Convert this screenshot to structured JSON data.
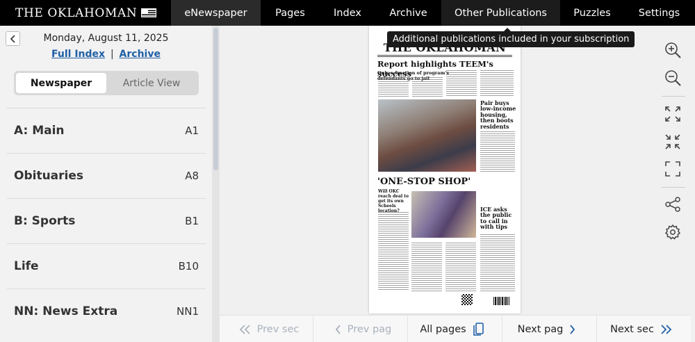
{
  "header": {
    "brand": "THE OKLAHOMAN",
    "nav": [
      {
        "label": "eNewspaper",
        "state": "active"
      },
      {
        "label": "Pages",
        "state": ""
      },
      {
        "label": "Index",
        "state": ""
      },
      {
        "label": "Archive",
        "state": ""
      },
      {
        "label": "Other Publications",
        "state": "hover"
      },
      {
        "label": "Puzzles",
        "state": ""
      },
      {
        "label": "Settings",
        "state": ""
      }
    ]
  },
  "sidebar": {
    "back_icon": "chevron-left-icon",
    "date": "Monday, August 11, 2025",
    "full_index_label": "Full Index",
    "separator": "|",
    "archive_label": "Archive",
    "toggle": {
      "newspaper": "Newspaper",
      "article_view": "Article View",
      "selected": "newspaper"
    },
    "sections": [
      {
        "name": "A: Main",
        "page": "A1"
      },
      {
        "name": "Obituaries",
        "page": "A8"
      },
      {
        "name": "B: Sports",
        "page": "B1"
      },
      {
        "name": "Life",
        "page": "B10"
      },
      {
        "name": "NN: News Extra",
        "page": "NN1"
      }
    ]
  },
  "tooltip": "Additional publications included in your subscription",
  "newspaper_page": {
    "masthead": "THE OKLAHOMAN",
    "headline": "Report highlights TEEM's success",
    "subhead": "Only a fraction of program's defendants go to jail",
    "sidebar_headline": "Pair buys low-income housing, then boots residents",
    "feature_headline": "'ONE-STOP SHOP'",
    "feature_subhead": "Will OKC reach deal to get its own Scheels location?",
    "ice_headline": "ICE asks the public to call in with tips"
  },
  "tools": [
    "zoom-in-icon",
    "zoom-out-icon",
    "fit-expand-icon",
    "fit-collapse-icon",
    "fullscreen-icon",
    "share-icon",
    "settings-icon"
  ],
  "bottom_nav": {
    "prev_section": "Prev sec",
    "prev_page": "Prev pag",
    "all_pages": "All pages",
    "next_page": "Next pag",
    "next_section": "Next sec"
  },
  "colors": {
    "accent_link": "#1f5fa6",
    "topbar": "#000000",
    "nav_active": "#2b2b2b",
    "disabled": "#aab2bd",
    "icon": "#444444"
  }
}
